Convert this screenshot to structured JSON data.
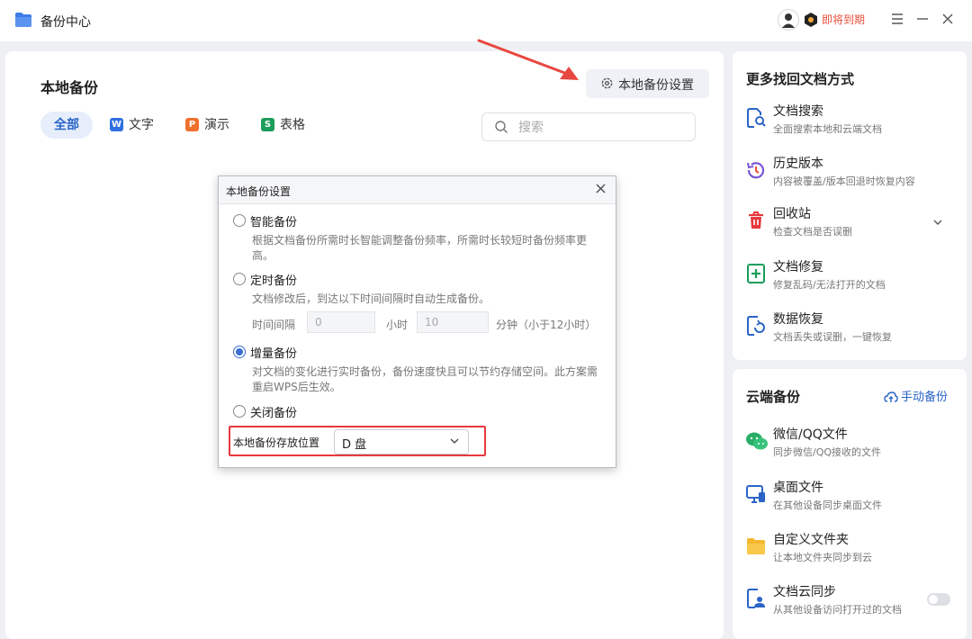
{
  "app": {
    "title": "备份中心",
    "expire_text": "即将到期"
  },
  "main": {
    "title": "本地备份",
    "settings_button": "本地备份设置",
    "tabs": [
      {
        "label": "全部"
      },
      {
        "label": "文字",
        "badge": "W",
        "color": "#2f6fe0"
      },
      {
        "label": "演示",
        "badge": "P",
        "color": "#f0702e"
      },
      {
        "label": "表格",
        "badge": "S",
        "color": "#1c9d5a"
      }
    ],
    "search_placeholder": "搜索"
  },
  "dialog": {
    "title": "本地备份设置",
    "options": [
      {
        "label": "智能备份",
        "desc": "根据文档备份所需时长智能调整备份频率，所需时长较短时备份频率更高。",
        "checked": false
      },
      {
        "label": "定时备份",
        "desc": "文档修改后，到达以下时间间隔时自动生成备份。",
        "checked": false
      },
      {
        "label": "增量备份",
        "desc": "对文档的变化进行实时备份，备份速度快且可以节约存储空间。此方案需重启WPS后生效。",
        "checked": true
      },
      {
        "label": "关闭备份",
        "desc": "",
        "checked": false
      }
    ],
    "interval": {
      "label": "时间间隔",
      "hours_value": "0",
      "hours_unit": "小时",
      "minutes_value": "10",
      "minutes_unit": "分钟（小于12小时）"
    },
    "location_label": "本地备份存放位置",
    "location_value": "D 盘"
  },
  "more_ways": {
    "title": "更多找回文档方式",
    "items": [
      {
        "title": "文档搜索",
        "desc": "全面搜索本地和云端文档"
      },
      {
        "title": "历史版本",
        "desc": "内容被覆盖/版本回退时恢复内容"
      },
      {
        "title": "回收站",
        "desc": "检查文档是否误删"
      },
      {
        "title": "文档修复",
        "desc": "修复乱码/无法打开的文档"
      },
      {
        "title": "数据恢复",
        "desc": "文档丢失或误删，一键恢复"
      }
    ]
  },
  "cloud": {
    "title": "云端备份",
    "manual_backup": "手动备份",
    "items": [
      {
        "title": "微信/QQ文件",
        "desc": "同步微信/QQ接收的文件"
      },
      {
        "title": "桌面文件",
        "desc": "在其他设备同步桌面文件"
      },
      {
        "title": "自定义文件夹",
        "desc": "让本地文件夹同步到云"
      },
      {
        "title": "文档云同步",
        "desc": "从其他设备访问打开过的文档",
        "toggle_on": false
      }
    ]
  },
  "colors": {
    "accent": "#2a64c7",
    "highlight": "#e8383d",
    "expire": "#e8503a"
  }
}
